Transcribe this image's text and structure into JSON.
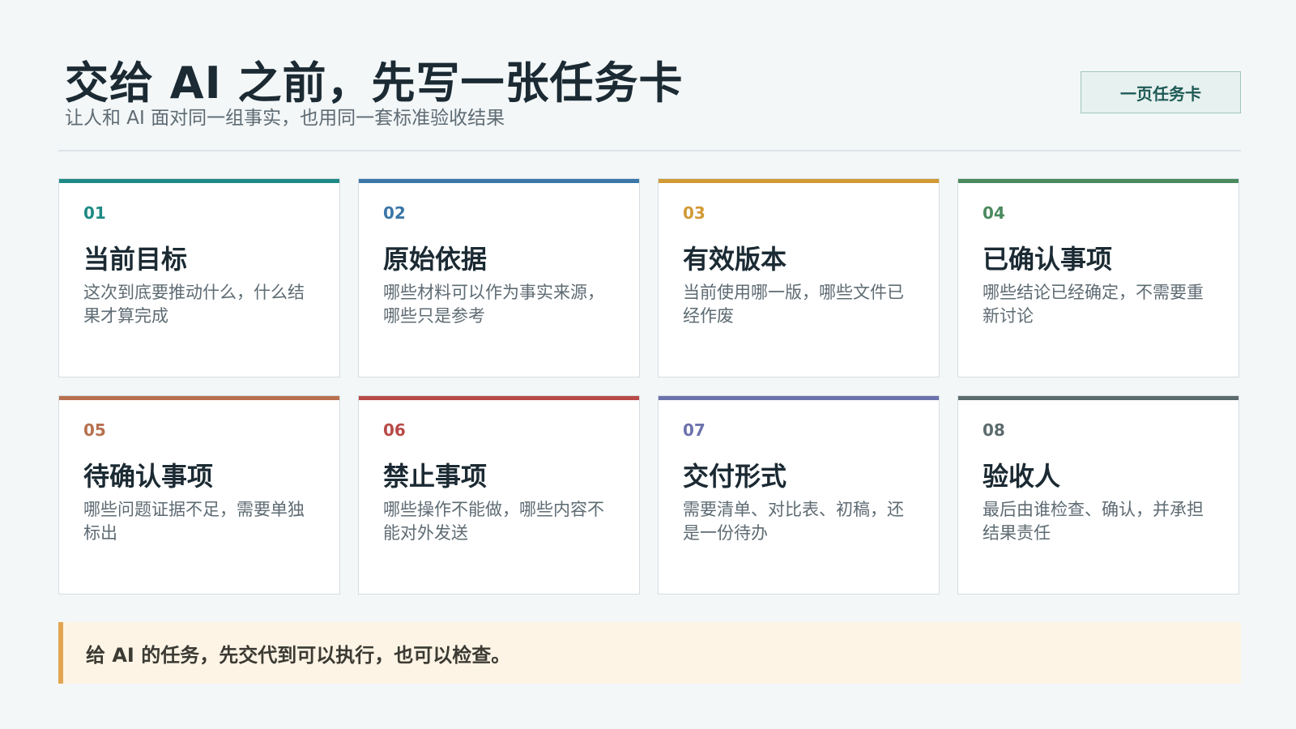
{
  "header": {
    "title": "交给 AI 之前，先写一张任务卡",
    "subtitle": "让人和 AI 面对同一组事实，也用同一套标准验收结果",
    "badge": "一页任务卡"
  },
  "cards": [
    {
      "num": "01",
      "title": "当前目标",
      "desc": "这次到底要推动什么，什么结果才算完成",
      "color": "#1f8a85"
    },
    {
      "num": "02",
      "title": "原始依据",
      "desc": "哪些材料可以作为事实来源，哪些只是参考",
      "color": "#3b76a8"
    },
    {
      "num": "03",
      "title": "有效版本",
      "desc": "当前使用哪一版，哪些文件已经作废",
      "color": "#d19a35"
    },
    {
      "num": "04",
      "title": "已确认事项",
      "desc": "哪些结论已经确定，不需要重新讨论",
      "color": "#4a8a5e"
    },
    {
      "num": "05",
      "title": "待确认事项",
      "desc": "哪些问题证据不足，需要单独标出",
      "color": "#b8704f"
    },
    {
      "num": "06",
      "title": "禁止事项",
      "desc": "哪些操作不能做，哪些内容不能对外发送",
      "color": "#b84a47"
    },
    {
      "num": "07",
      "title": "交付形式",
      "desc": "需要清单、对比表、初稿，还是一份待办",
      "color": "#6c72ab"
    },
    {
      "num": "08",
      "title": "验收人",
      "desc": "最后由谁检查、确认，并承担结果责任",
      "color": "#5c6b6e"
    }
  ],
  "footer": {
    "note": "给 AI 的任务，先交代到可以执行，也可以检查。",
    "accent": "#e3a552"
  }
}
